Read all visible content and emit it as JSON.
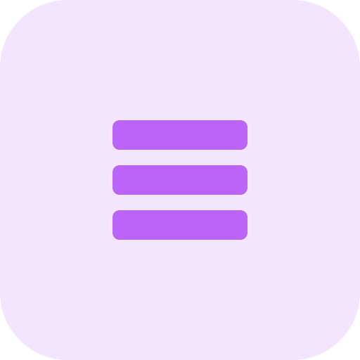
{
  "app_icon": {
    "icon": "menu-icon",
    "colors": {
      "tile_background": "#F3E5FD",
      "bars": "#BA64F8"
    }
  }
}
